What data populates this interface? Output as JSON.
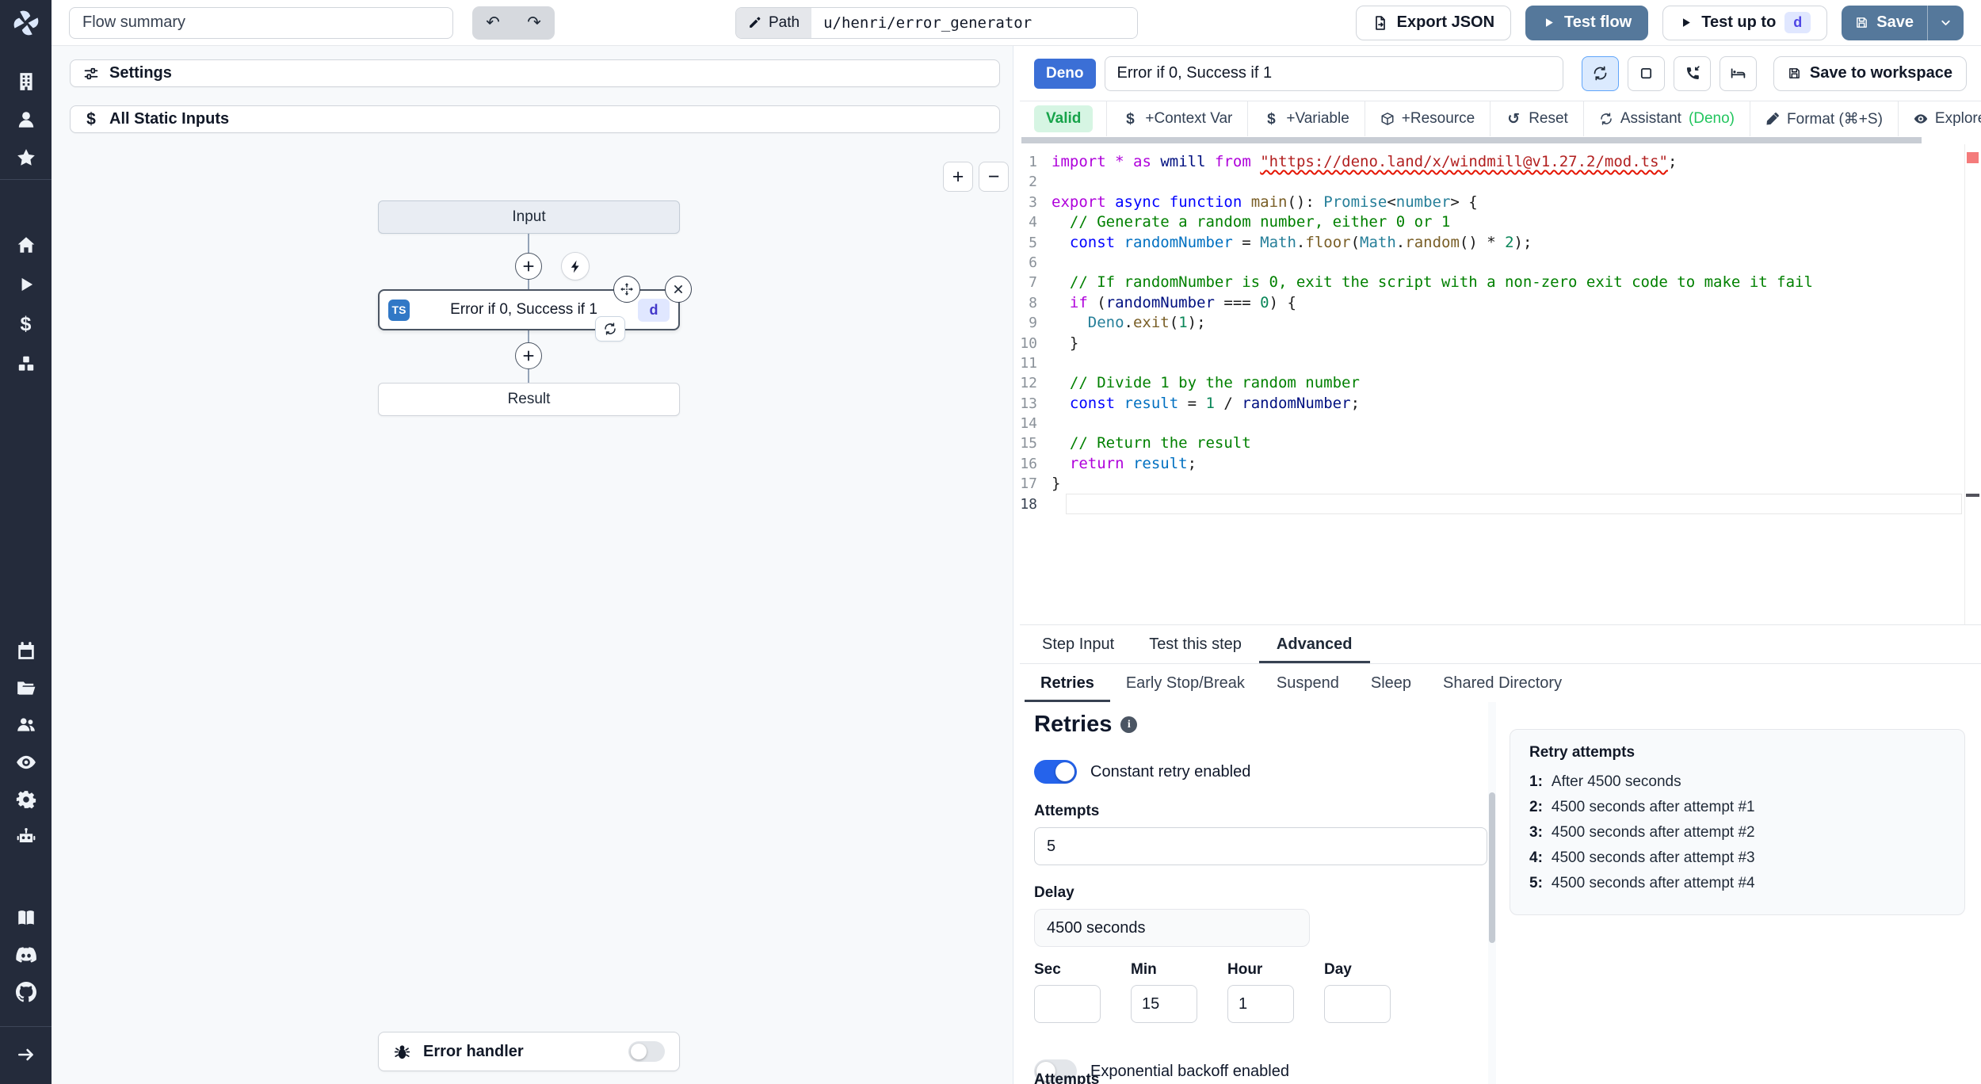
{
  "topbar": {
    "flow_summary_placeholder": "Flow summary",
    "path_label": "Path",
    "path_value": "u/henri/error_generator",
    "export_json_label": "Export JSON",
    "test_flow_label": "Test flow",
    "test_up_to_label": "Test up to",
    "test_up_to_step_badge": "d",
    "save_label": "Save"
  },
  "sidebar": {
    "icon_groups": [
      [
        "building",
        "user",
        "star"
      ],
      [
        "home",
        "play",
        "dollar",
        "cubes"
      ],
      [
        "calendar",
        "folder-open",
        "user-group",
        "eye",
        "gear",
        "robot"
      ],
      [
        "book",
        "discord",
        "github"
      ],
      [
        "arrow-right"
      ]
    ]
  },
  "canvas": {
    "settings_label": "Settings",
    "all_static_inputs_label": "All Static Inputs",
    "zoom_in_label": "+",
    "zoom_out_label": "−",
    "nodes": {
      "input_label": "Input",
      "step_lang_badge": "TS",
      "step_label": "Error if 0, Success if 1",
      "step_id_badge": "d",
      "result_label": "Result",
      "error_handler_label": "Error handler"
    }
  },
  "step_panel": {
    "lang_badge": "Deno",
    "name_value": "Error if 0, Success if 1",
    "save_to_workspace_label": "Save to workspace",
    "status_badge": "Valid",
    "toolbar": [
      {
        "icon": "dollar",
        "label": "+Context Var"
      },
      {
        "icon": "dollar",
        "label": "+Variable"
      },
      {
        "icon": "package",
        "label": "+Resource"
      },
      {
        "icon": "reset",
        "label": "Reset"
      },
      {
        "icon": "repeat",
        "label": "Assistant ",
        "accent": "(Deno)"
      },
      {
        "icon": "pen",
        "label": "Format (⌘+S)"
      },
      {
        "icon": "eye",
        "label": "Explore other s"
      }
    ]
  },
  "editor": {
    "active_line": 18,
    "lines": [
      {
        "n": 1,
        "tokens": [
          [
            "import",
            "ctrl"
          ],
          [
            " ",
            "pl"
          ],
          [
            "*",
            "ctrl"
          ],
          [
            " ",
            "pl"
          ],
          [
            "as",
            "ctrl"
          ],
          [
            " ",
            "pl"
          ],
          [
            "wmill",
            "var"
          ],
          [
            " ",
            "pl"
          ],
          [
            "from",
            "ctrl"
          ],
          [
            " ",
            "pl"
          ],
          [
            "\"https://deno.land/x/windmill@v1.27.2/mod.ts\"",
            "strerr"
          ],
          [
            ";",
            "pl"
          ]
        ]
      },
      {
        "n": 2,
        "tokens": []
      },
      {
        "n": 3,
        "tokens": [
          [
            "export",
            "ctrl"
          ],
          [
            " ",
            "pl"
          ],
          [
            "async",
            "kw"
          ],
          [
            " ",
            "pl"
          ],
          [
            "function",
            "kw"
          ],
          [
            " ",
            "pl"
          ],
          [
            "main",
            "fn"
          ],
          [
            "(): ",
            "pl"
          ],
          [
            "Promise",
            "type"
          ],
          [
            "<",
            "pl"
          ],
          [
            "number",
            "type"
          ],
          [
            "> {",
            "pl"
          ]
        ]
      },
      {
        "n": 4,
        "tokens": [
          [
            "  ",
            "pl"
          ],
          [
            "// Generate a random number, either 0 or 1",
            "com"
          ]
        ]
      },
      {
        "n": 5,
        "tokens": [
          [
            "  ",
            "pl"
          ],
          [
            "const",
            "kw"
          ],
          [
            " ",
            "pl"
          ],
          [
            "randomNumber",
            "cvar"
          ],
          [
            " = ",
            "pl"
          ],
          [
            "Math",
            "type"
          ],
          [
            ".",
            "pl"
          ],
          [
            "floor",
            "fn"
          ],
          [
            "(",
            "pl"
          ],
          [
            "Math",
            "type"
          ],
          [
            ".",
            "pl"
          ],
          [
            "random",
            "fn"
          ],
          [
            "() * ",
            "pl"
          ],
          [
            "2",
            "num"
          ],
          [
            ");",
            "pl"
          ]
        ]
      },
      {
        "n": 6,
        "tokens": []
      },
      {
        "n": 7,
        "tokens": [
          [
            "  ",
            "pl"
          ],
          [
            "// If randomNumber is 0, exit the script with a non-zero exit code to make it fail",
            "com"
          ]
        ]
      },
      {
        "n": 8,
        "tokens": [
          [
            "  ",
            "pl"
          ],
          [
            "if",
            "ctrl"
          ],
          [
            " (",
            "pl"
          ],
          [
            "randomNumber",
            "var"
          ],
          [
            " === ",
            "pl"
          ],
          [
            "0",
            "num"
          ],
          [
            ") {",
            "pl"
          ]
        ]
      },
      {
        "n": 9,
        "tokens": [
          [
            "    ",
            "pl"
          ],
          [
            "Deno",
            "type"
          ],
          [
            ".",
            "pl"
          ],
          [
            "exit",
            "fn"
          ],
          [
            "(",
            "pl"
          ],
          [
            "1",
            "num"
          ],
          [
            ");",
            "pl"
          ]
        ]
      },
      {
        "n": 10,
        "tokens": [
          [
            "  }",
            "pl"
          ]
        ]
      },
      {
        "n": 11,
        "tokens": []
      },
      {
        "n": 12,
        "tokens": [
          [
            "  ",
            "pl"
          ],
          [
            "// Divide 1 by the random number",
            "com"
          ]
        ]
      },
      {
        "n": 13,
        "tokens": [
          [
            "  ",
            "pl"
          ],
          [
            "const",
            "kw"
          ],
          [
            " ",
            "pl"
          ],
          [
            "result",
            "cvar"
          ],
          [
            " = ",
            "pl"
          ],
          [
            "1",
            "num"
          ],
          [
            " / ",
            "pl"
          ],
          [
            "randomNumber",
            "var"
          ],
          [
            ";",
            "pl"
          ]
        ]
      },
      {
        "n": 14,
        "tokens": []
      },
      {
        "n": 15,
        "tokens": [
          [
            "  ",
            "pl"
          ],
          [
            "// Return the result",
            "com"
          ]
        ]
      },
      {
        "n": 16,
        "tokens": [
          [
            "  ",
            "pl"
          ],
          [
            "return",
            "ctrl"
          ],
          [
            " ",
            "pl"
          ],
          [
            "result",
            "cvar"
          ],
          [
            ";",
            "pl"
          ]
        ]
      },
      {
        "n": 17,
        "tokens": [
          [
            "}",
            "pl"
          ]
        ]
      },
      {
        "n": 18,
        "tokens": []
      }
    ]
  },
  "advanced": {
    "tabs": [
      "Step Input",
      "Test this step",
      "Advanced"
    ],
    "active_tab": "Advanced",
    "subtabs": [
      "Retries",
      "Early Stop/Break",
      "Suspend",
      "Sleep",
      "Shared Directory"
    ],
    "active_subtab": "Retries",
    "retries": {
      "title": "Retries",
      "constant_toggle_label": "Constant retry enabled",
      "constant_enabled": true,
      "attempts_label": "Attempts",
      "attempts_value": "5",
      "delay_label": "Delay",
      "delay_value": "4500 seconds",
      "time_units": [
        {
          "label": "Sec",
          "value": ""
        },
        {
          "label": "Min",
          "value": "15"
        },
        {
          "label": "Hour",
          "value": "1"
        },
        {
          "label": "Day",
          "value": ""
        }
      ],
      "exponential_toggle_label": "Exponential backoff enabled",
      "exponential_enabled": false,
      "clipped_bottom_label": "Attempts",
      "preview": {
        "title": "Retry attempts",
        "items": [
          {
            "n": "1:",
            "text": "After 4500 seconds"
          },
          {
            "n": "2:",
            "text": "4500 seconds after attempt #1"
          },
          {
            "n": "3:",
            "text": "4500 seconds after attempt #2"
          },
          {
            "n": "4:",
            "text": "4500 seconds after attempt #3"
          },
          {
            "n": "5:",
            "text": "4500 seconds after attempt #4"
          }
        ]
      }
    }
  },
  "colors": {
    "primary_button": "#55789b",
    "deno_badge": "#3b6fd6",
    "valid_bg": "#d6f5e3",
    "valid_text": "#17a34a",
    "toggle_on": "#2563eb",
    "ts_badge": "#3178c6",
    "lang_chip_bg": "#e0e7ff",
    "lang_chip_text": "#4338ca",
    "assistant_accent": "#22c55e",
    "error_marker": "#f47b7b"
  },
  "syntax": {
    "pl": "#1b1b1b",
    "kw": "#0000ff",
    "ctrl": "#af00db",
    "str": "#b21f1f",
    "com": "#008000",
    "type": "#267f99",
    "fn": "#795e26",
    "var": "#001080",
    "cvar": "#0070c1",
    "num": "#098658",
    "squig": "#e51400"
  }
}
